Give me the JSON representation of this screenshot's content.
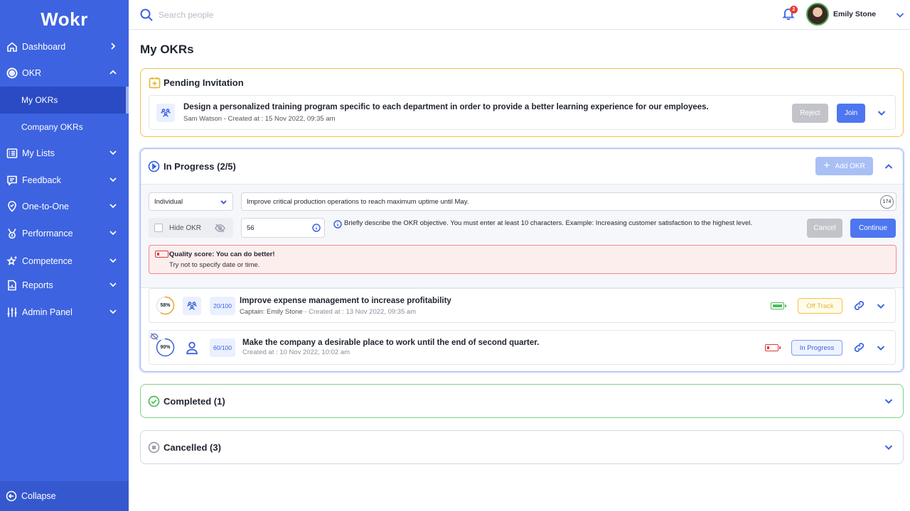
{
  "app": {
    "logo": "Wokr"
  },
  "sidebar": {
    "items": [
      {
        "label": "Dashboard",
        "icon": "home-icon"
      },
      {
        "label": "OKR",
        "icon": "target-icon"
      },
      {
        "label": "My Lists",
        "icon": "list-icon"
      },
      {
        "label": "Feedback",
        "icon": "feedback-icon"
      },
      {
        "label": "One-to-One",
        "icon": "location-icon"
      },
      {
        "label": "Performance",
        "icon": "medal-icon"
      },
      {
        "label": "Competence",
        "icon": "star-icon"
      },
      {
        "label": "Reports",
        "icon": "report-icon"
      },
      {
        "label": "Admin Panel",
        "icon": "sliders-icon"
      }
    ],
    "okr_sub": [
      {
        "label": "My OKRs",
        "active": true
      },
      {
        "label": "Company OKRs",
        "active": false
      }
    ],
    "collapse_label": "Collapse"
  },
  "topbar": {
    "search_placeholder": "Search people",
    "notification_count": "2",
    "user_name": "Emily Stone"
  },
  "page": {
    "title": "My OKRs"
  },
  "pending": {
    "title": "Pending Invitation",
    "item": {
      "title": "Design a personalized training program specific to each department in order to provide a better learning experience for our employees.",
      "owner": "Sam Watson",
      "created": " - Created at : 15 Nov 2022, 09:35 am"
    },
    "reject_label": "Reject",
    "join_label": "Join"
  },
  "in_progress": {
    "title": "In Progress (2/5)",
    "add_label": "Add OKR",
    "form": {
      "type_value": "Individual",
      "objective_value": "Improve critical production operations to reach maximum uptime until May.",
      "char_count": "174",
      "hide_label": "Hide OKR",
      "number_value": "56",
      "hint": "Briefly describe the OKR objective. You must enter at least 10 characters. Example: Increasing customer satisfaction to the highest level.",
      "cancel_label": "Cancel",
      "continue_label": "Continue",
      "quality_title": "Quality score: You can do better!",
      "quality_sub": "Try not to specify date or time."
    },
    "rows": [
      {
        "progress": "58%",
        "progress_value": 58,
        "score": "20/100",
        "title": "Improve expense management to increase profitability",
        "captain": "Captain: Emily Stone",
        "created": " - Created at : 13 Nov 2022, 09:35 am",
        "status": "Off Track"
      },
      {
        "progress": "90%",
        "progress_value": 90,
        "score": "60/100",
        "title": "Make the company a desirable place to work until the end of second quarter.",
        "created": "Created at : 10 Nov 2022, 10:02 am",
        "status": "In Progress"
      }
    ]
  },
  "completed": {
    "title": "Completed (1)"
  },
  "cancelled": {
    "title": "Cancelled (3)"
  },
  "colors": {
    "brand": "#3d63e0",
    "warning": "#f2c24a",
    "success": "#4cbb5a",
    "danger": "#d93b3b"
  }
}
